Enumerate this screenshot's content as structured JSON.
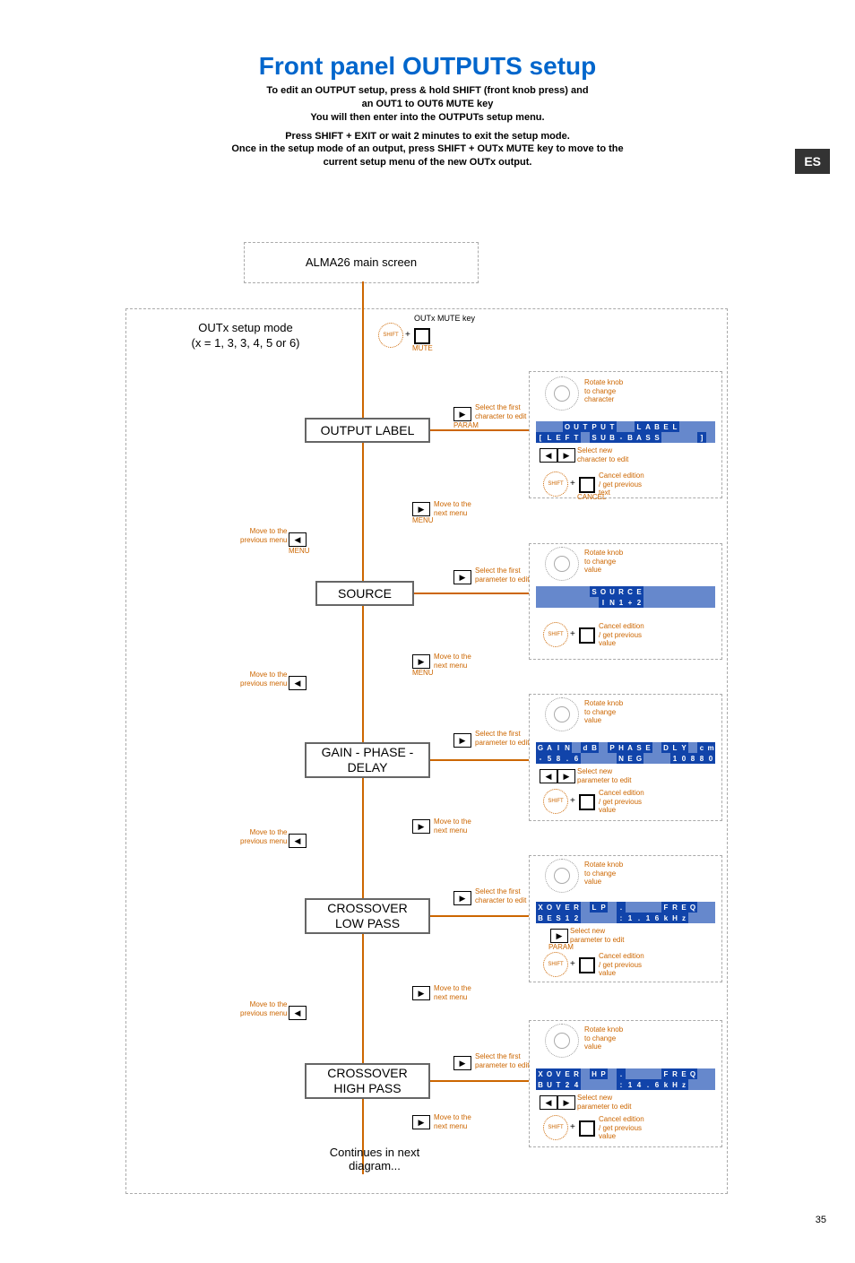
{
  "title": "Front panel OUTPUTS setup",
  "intro": {
    "l1": "To edit an OUTPUT setup, press & hold SHIFT (front knob press) and",
    "l2": "an OUT1 to OUT6 MUTE key",
    "l3": "You will then enter into the OUTPUTs setup menu.",
    "l4": "Press SHIFT + EXIT or wait 2 minutes to exit the setup mode.",
    "l5": "Once in the setup mode of an output, press SHIFT + OUTx MUTE key to move to the",
    "l6": "current setup menu of the new OUTx output."
  },
  "lang": "ES",
  "page_num": "35",
  "main_box": "ALMA26 main screen",
  "setup_box": {
    "l1": "OUTx setup mode",
    "l2": "(x = 1, 3, 3, 4, 5 or 6)"
  },
  "mute_key": "OUTx MUTE key",
  "shift_label": "SHIFT",
  "mute_label": "MUTE",
  "steps": [
    {
      "name": "OUTPUT LABEL"
    },
    {
      "name": "SOURCE"
    },
    {
      "name": "GAIN - PHASE - DELAY"
    },
    {
      "name": "CROSSOVER LOW PASS"
    },
    {
      "name": "CROSSOVER HIGH PASS"
    }
  ],
  "continues": "Continues in next diagram...",
  "hints": {
    "first_char": "Select the first\ncharacter to edit",
    "first_param": "Select the first\nparameter to edit",
    "next_menu": "Move to the\nnext menu",
    "prev_menu": "Move to the\nprevious menu",
    "rotate_char": "Rotate knob\nto change\ncharacter",
    "rotate_val": "Rotate knob\nto change\nvalue",
    "new_char": "Select new\ncharacter to edit",
    "new_param": "Select new\nparameter to edit",
    "cancel_text": "Cancel edition\n/ get previous\ntext",
    "cancel_val": "Cancel edition\n/ get previous\nvalue",
    "param_label": "PARAM",
    "menu_label": "MENU",
    "cancel_label": "CANCEL"
  },
  "lcd": {
    "output_label": {
      "r1": "   OUTPUT  LABEL    ",
      "r2": "[LEFT SUB-BASS    ]"
    },
    "source": {
      "r1": "      SOURCE        ",
      "r2": "       IN1+2        "
    },
    "gain": {
      "r1": "GAIN dB PHASE DLY cm",
      "r2": "-58.6    NEG   10880"
    },
    "xover_lp": {
      "r1": "XOVER LP .    FREQ  ",
      "r2": "BES12    :1.16kHz   "
    },
    "xover_hp": {
      "r1": "XOVER HP .    FREQ  ",
      "r2": "BUT24    :14.6kHz   "
    }
  }
}
